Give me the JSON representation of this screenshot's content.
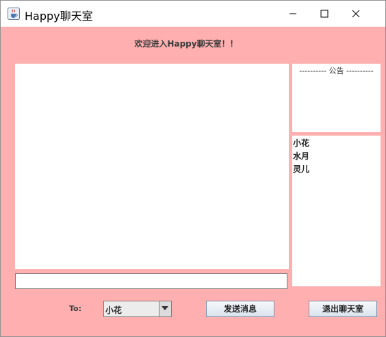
{
  "window": {
    "title": "Happy聊天室",
    "controls": {
      "minimize": "minimize-icon",
      "maximize": "maximize-icon",
      "close": "close-icon"
    }
  },
  "welcome_text": "欢迎进入Happy聊天室！！",
  "notice": {
    "title": "----------  公告  ----------"
  },
  "users": [
    "小花",
    "水月",
    "灵儿"
  ],
  "message_input": {
    "value": ""
  },
  "recipient": {
    "label": "To:",
    "selected": "小花"
  },
  "buttons": {
    "send": "发送消息",
    "exit": "退出聊天室"
  },
  "colors": {
    "background": "#ffafaf",
    "panel": "#ffffff"
  }
}
